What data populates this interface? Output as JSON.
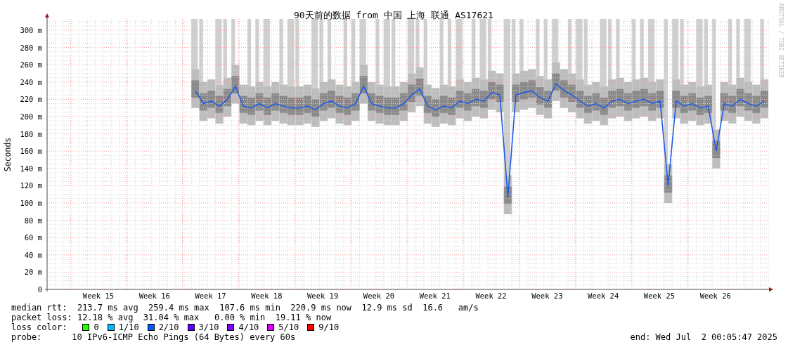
{
  "chart": {
    "chart_data": {
      "type": "line",
      "title": "90天前的数据 from 中国 上海 联通 AS17621",
      "ylabel": "Seconds",
      "grid": true,
      "ylim": [
        0,
        313
      ],
      "yticks": [
        {
          "value": 0,
          "label": "0"
        },
        {
          "value": 20,
          "label": "20 m"
        },
        {
          "value": 40,
          "label": "40 m"
        },
        {
          "value": 60,
          "label": "60 m"
        },
        {
          "value": 80,
          "label": "80 m"
        },
        {
          "value": 100,
          "label": "100 m"
        },
        {
          "value": 120,
          "label": "120 m"
        },
        {
          "value": 140,
          "label": "140 m"
        },
        {
          "value": 160,
          "label": "160 m"
        },
        {
          "value": 180,
          "label": "180 m"
        },
        {
          "value": 200,
          "label": "200 m"
        },
        {
          "value": 220,
          "label": "220 m"
        },
        {
          "value": 240,
          "label": "240 m"
        },
        {
          "value": 260,
          "label": "260 m"
        },
        {
          "value": 280,
          "label": "280 m"
        },
        {
          "value": 300,
          "label": "300 m"
        }
      ],
      "categories": [
        null,
        null,
        null,
        null,
        null,
        null,
        "Week 15",
        null,
        null,
        null,
        null,
        null,
        null,
        "Week 16",
        null,
        null,
        null,
        null,
        null,
        null,
        "Week 17",
        null,
        null,
        null,
        null,
        null,
        null,
        "Week 18",
        null,
        null,
        null,
        null,
        null,
        null,
        "Week 19",
        null,
        null,
        null,
        null,
        null,
        null,
        "Week 20",
        null,
        null,
        null,
        null,
        null,
        null,
        "Week 21",
        null,
        null,
        null,
        null,
        null,
        null,
        "Week 22",
        null,
        null,
        null,
        null,
        null,
        null,
        "Week 23",
        null,
        null,
        null,
        null,
        null,
        null,
        "Week 24",
        null,
        null,
        null,
        null,
        null,
        null,
        "Week 25",
        null,
        null,
        null,
        null,
        null,
        null,
        "Week 26",
        null,
        null,
        null,
        null,
        null,
        null
      ],
      "series": [
        {
          "color": "#1e5be6",
          "values": [
            null,
            null,
            null,
            null,
            null,
            null,
            null,
            null,
            null,
            null,
            null,
            null,
            null,
            null,
            null,
            null,
            null,
            null,
            230,
            215,
            218,
            212,
            220,
            235,
            212,
            210,
            215,
            210,
            215,
            212,
            210,
            210,
            212,
            208,
            215,
            218,
            212,
            210,
            215,
            235,
            215,
            212,
            210,
            210,
            215,
            225,
            232,
            212,
            208,
            212,
            210,
            218,
            215,
            220,
            218,
            228,
            225,
            107,
            225,
            228,
            230,
            222,
            218,
            238,
            230,
            225,
            218,
            212,
            215,
            210,
            218,
            220,
            215,
            218,
            220,
            215,
            218,
            120,
            218,
            212,
            215,
            210,
            212,
            160,
            215,
            212,
            220,
            215,
            212,
            218
          ]
        }
      ]
    }
  },
  "side_note": "RRDTOOL / TOBI OETIKER",
  "legend": {
    "median_rtt": "median rtt:  213.7 ms avg  259.4 ms max  107.6 ms min  220.9 ms now  12.9 ms sd  16.6   am/s",
    "packet_loss": "packet loss: 12.18 % avg  31.04 % max   0.00 % min  19.11 % now",
    "loss_color_label": "loss color:",
    "loss_colors": [
      {
        "label": "0",
        "color": "#26ff00"
      },
      {
        "label": "1/10",
        "color": "#00b8ff"
      },
      {
        "label": "2/10",
        "color": "#0059ff"
      },
      {
        "label": "3/10",
        "color": "#5e00ff"
      },
      {
        "label": "4/10",
        "color": "#7e00ff"
      },
      {
        "label": "5/10",
        "color": "#dd00ff"
      },
      {
        "label": "9/10",
        "color": "#ff0000"
      }
    ],
    "probe_label": "probe:",
    "probe": "10 IPv6-ICMP Echo Pings (64 Bytes) every 60s",
    "end": "end: Wed Jul  2 00:05:47 2025"
  }
}
